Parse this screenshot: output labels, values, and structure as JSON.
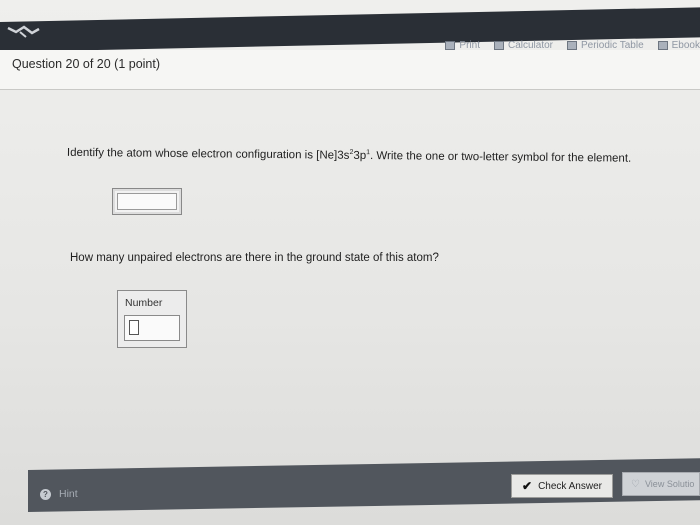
{
  "toolbar": {
    "print": "Print",
    "calculator": "Calculator",
    "periodic_table": "Periodic Table",
    "ebook": "Ebook"
  },
  "question": {
    "title": "Question 20 of 20 (1 point)",
    "part1_text_a": "Identify the atom whose electron configuration is [Ne]3s",
    "part1_sup1": "2",
    "part1_text_b": "3p",
    "part1_sup2": "1",
    "part1_text_c": ". Write the one or two-letter symbol for the element.",
    "part1_value": "",
    "part2_text": "How many unpaired electrons are there in the ground state of this atom?",
    "part2_label": "Number",
    "part2_value": ""
  },
  "footer": {
    "hint": "Hint",
    "check_answer": "Check Answer",
    "view_solution": "View Solutio"
  }
}
